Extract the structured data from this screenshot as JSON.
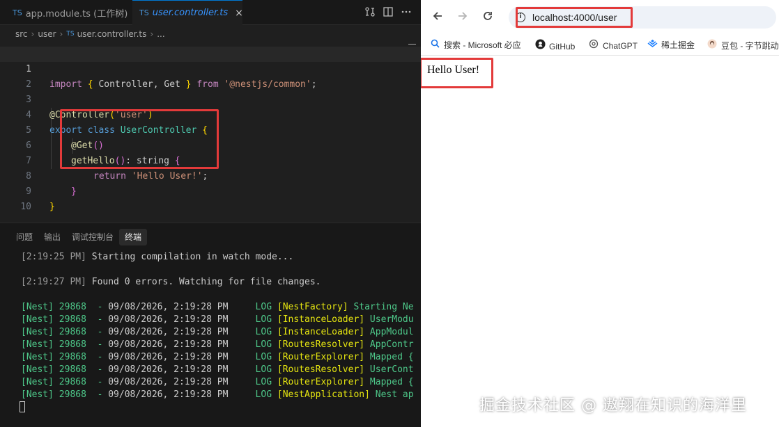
{
  "editor": {
    "tabs": [
      {
        "icon": "TS",
        "label": "app.module.ts (工作树)"
      },
      {
        "icon": "TS",
        "label": "user.controller.ts",
        "close": "×"
      }
    ],
    "breadcrumb": [
      "src",
      "user",
      "user.controller.ts",
      "..."
    ],
    "breadcrumb_file_icon": "TS",
    "line_numbers": [
      "1",
      "2",
      "3",
      "4",
      "5",
      "6",
      "7",
      "8",
      "9",
      "10"
    ],
    "code": {
      "l1": {
        "kw": "import",
        "open": " { ",
        "names": "Controller, Get",
        "close": " } ",
        "from": "from",
        "str": "'@nestjs/common'",
        "end": ";"
      },
      "l3": {
        "dec": "@Controller",
        "open": "(",
        "str": "'user'",
        "close": ")"
      },
      "l4": {
        "export": "export",
        "class": "class",
        "name": "UserController",
        "brace": " {"
      },
      "l5": {
        "dec": "@Get",
        "parens": "()"
      },
      "l6": {
        "fn": "getHello",
        "parens": "()",
        "sig": ": string ",
        "brace": "{"
      },
      "l7": {
        "kw": "return",
        "str": "'Hello User!'",
        "end": ";"
      },
      "l8": {
        "brace": "}"
      },
      "l9": {
        "brace": "}"
      }
    }
  },
  "panel": {
    "tabs": [
      "问题",
      "输出",
      "调试控制台",
      "终端"
    ],
    "active_tab": "终端",
    "terminal": {
      "line1": {
        "time": "[2:19:25 PM]",
        "msg": " Starting compilation in watch mode..."
      },
      "line2": {
        "time": "[2:19:27 PM]",
        "msg": " Found 0 errors. Watching for file changes."
      },
      "logs": [
        {
          "prefix": "[Nest] 29868  -",
          "ts": " 09/08/2026, 2:19:28 PM",
          "level": "     LOG",
          "ctx": " [NestFactory]",
          "msg": " Starting Ne"
        },
        {
          "prefix": "[Nest] 29868  -",
          "ts": " 09/08/2026, 2:19:28 PM",
          "level": "     LOG",
          "ctx": " [InstanceLoader]",
          "msg": " UserModu"
        },
        {
          "prefix": "[Nest] 29868  -",
          "ts": " 09/08/2026, 2:19:28 PM",
          "level": "     LOG",
          "ctx": " [InstanceLoader]",
          "msg": " AppModul"
        },
        {
          "prefix": "[Nest] 29868  -",
          "ts": " 09/08/2026, 2:19:28 PM",
          "level": "     LOG",
          "ctx": " [RoutesResolver]",
          "msg": " AppContr"
        },
        {
          "prefix": "[Nest] 29868  -",
          "ts": " 09/08/2026, 2:19:28 PM",
          "level": "     LOG",
          "ctx": " [RouterExplorer]",
          "msg": " Mapped {"
        },
        {
          "prefix": "[Nest] 29868  -",
          "ts": " 09/08/2026, 2:19:28 PM",
          "level": "     LOG",
          "ctx": " [RoutesResolver]",
          "msg": " UserCont"
        },
        {
          "prefix": "[Nest] 29868  -",
          "ts": " 09/08/2026, 2:19:28 PM",
          "level": "     LOG",
          "ctx": " [RouterExplorer]",
          "msg": " Mapped {"
        },
        {
          "prefix": "[Nest] 29868  -",
          "ts": " 09/08/2026, 2:19:28 PM",
          "level": "     LOG",
          "ctx": " [NestApplication]",
          "msg": " Nest ap"
        }
      ]
    }
  },
  "browser": {
    "url": "localhost:4000/user",
    "bookmarks": [
      {
        "icon": "search-icon",
        "label": "搜索 - Microsoft 必应"
      },
      {
        "icon": "github-icon",
        "label": "GitHub"
      },
      {
        "icon": "chatgpt-icon",
        "label": "ChatGPT"
      },
      {
        "icon": "juejin-icon",
        "label": "稀土掘金"
      },
      {
        "icon": "doubao-icon",
        "label": "豆包 - 字节跳动"
      }
    ],
    "page_text": "Hello User!"
  },
  "watermark": "掘金技术社区 @ 遨翔在知识的海洋里",
  "colors": {
    "annotation": "#e33a3a",
    "accent": "#0078d4"
  }
}
